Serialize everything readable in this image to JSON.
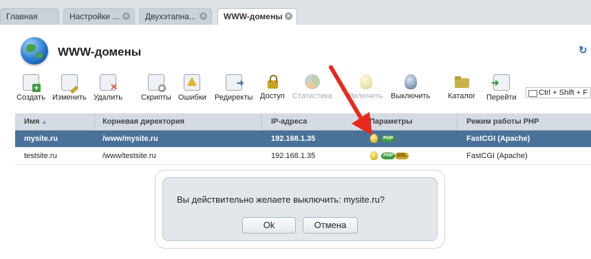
{
  "tabs": [
    {
      "label": "Главная",
      "closable": false,
      "active": false
    },
    {
      "label": "Настройки ...",
      "closable": true,
      "active": false
    },
    {
      "label": "Двухэтапна...",
      "closable": true,
      "active": false
    },
    {
      "label": "WWW-домены",
      "closable": true,
      "active": true
    }
  ],
  "page": {
    "title": "WWW-домены"
  },
  "toolbar": [
    {
      "label": "Создать",
      "icon": "create-icon",
      "color": "#3c9a3c",
      "enabled": true
    },
    {
      "label": "Изменить",
      "icon": "edit-icon",
      "color": "#c9a227",
      "enabled": true
    },
    {
      "label": "Удалить",
      "icon": "delete-icon",
      "color": "#d85a2a",
      "enabled": true
    },
    {
      "label": "Скрипты",
      "icon": "scripts-icon",
      "color": "#8a9098",
      "enabled": true
    },
    {
      "label": "Ошибки",
      "icon": "errors-icon",
      "color": "#e0b52a",
      "enabled": true
    },
    {
      "label": "Редиректы",
      "icon": "redirects-icon",
      "color": "#4a76b0",
      "enabled": true
    },
    {
      "label": "Доступ",
      "icon": "lock-icon",
      "color": "#c9a227",
      "enabled": true
    },
    {
      "label": "Статистика",
      "icon": "chart-icon",
      "color": "#b8bdc3",
      "enabled": false
    },
    {
      "label": "Включить",
      "icon": "bulb-on-icon",
      "color": "#e6dca0",
      "enabled": false
    },
    {
      "label": "Выключить",
      "icon": "bulb-off-icon",
      "color": "#7a8fb0",
      "enabled": true
    },
    {
      "label": "Каталог",
      "icon": "folder-icon",
      "color": "#c9b24a",
      "enabled": true
    },
    {
      "label": "Перейти",
      "icon": "go-icon",
      "color": "#3c9a3c",
      "enabled": true
    }
  ],
  "shortcut_hint": "Ctrl + Shift + F",
  "grid": {
    "columns": [
      "Имя",
      "Корневая директория",
      "IP-адреса",
      "Параметры",
      "Режим работы PHP"
    ],
    "sort_indicator": "▲",
    "rows": [
      {
        "name": "mysite.ru",
        "root": "/www/mysite.ru",
        "ip": "192.168.1.35",
        "params": [
          "bulb",
          "PHP"
        ],
        "php_mode": "FastCGI (Apache)",
        "selected": true
      },
      {
        "name": "testsite.ru",
        "root": "/www/testsite.ru",
        "ip": "192.168.1.35",
        "params": [
          "bulb",
          "PHP",
          "SSL"
        ],
        "php_mode": "FastCGI (Apache)",
        "selected": false
      }
    ]
  },
  "dialog": {
    "message": "Вы действительно желаете выключить: mysite.ru?",
    "ok_label": "Ok",
    "cancel_label": "Отмена"
  },
  "colors": {
    "selection": "#4a7299",
    "arrow": "#e8291c",
    "header": "#d4dbe2"
  }
}
